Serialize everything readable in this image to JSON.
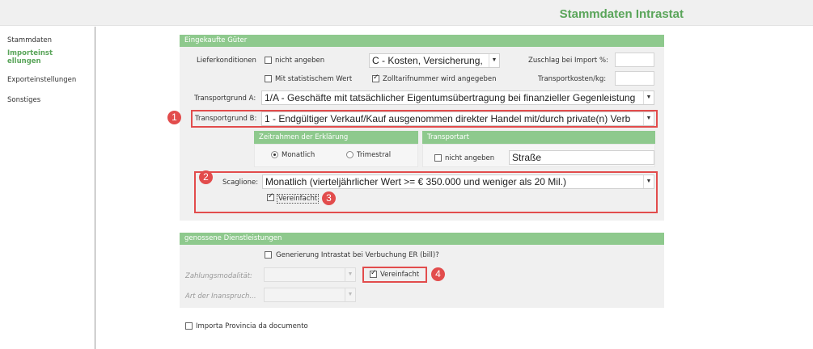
{
  "header": {
    "title": "Stammdaten Intrastat"
  },
  "sidebar": {
    "items": [
      {
        "label": "Stammdaten",
        "active": false
      },
      {
        "label": "Importeinstellungen",
        "active": true
      },
      {
        "label": "Exporteinstellungen",
        "active": false
      },
      {
        "label": "Sonstiges",
        "active": false
      }
    ]
  },
  "purchased": {
    "title": "Eingekaufte Güter",
    "delivery_label": "Lieferkonditionen",
    "not_specified_label": "nicht angeben",
    "not_specified_checked": false,
    "delivery_value": "C - Kosten, Versicherung,",
    "surcharge_label": "Zuschlag bei Import %:",
    "statistical_value_label": "Mit statistischem Wert",
    "statistical_value_checked": false,
    "tariff_number_label": "Zolltarifnummer wird angegeben",
    "tariff_number_checked": true,
    "transport_costs_label": "Transportkosten/kg:",
    "reason_a_label": "Transportgrund A:",
    "reason_a_value": "1/A - Geschäfte mit tatsächlicher Eigentumsübertragung bei finanzieller Gegenleistung",
    "reason_b_label": "Transportgrund B:",
    "reason_b_value": "1 - Endgültiger Verkauf/Kauf ausgenommen direkter Handel mit/durch private(n) Verb",
    "period": {
      "title": "Zeitrahmen der Erklärung",
      "monthly_label": "Monatlich",
      "quarterly_label": "Trimestral",
      "selected": "Monatlich"
    },
    "transport": {
      "title": "Transportart",
      "not_specified_label": "nicht angeben",
      "not_specified_checked": false,
      "value": "Straße"
    },
    "scaglione_label": "Scaglione:",
    "scaglione_value": "Monatlich (vierteljährlicher Wert >= € 350.000 und weniger als 20 Mil.)",
    "simplified_label": "Vereinfacht",
    "simplified_checked": true
  },
  "services": {
    "title": "genossene Dienstleistungen",
    "generate_label": "Generierung Intrastat bei Verbuchung ER (bill)?",
    "generate_checked": false,
    "payment_label": "Zahlungsmodalität:",
    "claim_label": "Art der Inanspruch...",
    "simplified_label": "Vereinfacht",
    "simplified_checked": true
  },
  "import_province_label": "Importa Provincia da documento",
  "import_province_checked": false,
  "callouts": [
    "1",
    "2",
    "3",
    "4"
  ],
  "colors": {
    "accent": "#5aa55a",
    "panel_header": "#8ec98d",
    "callout": "#e24c4c"
  },
  "icons": {
    "dropdown": "chevron-down-icon",
    "checkbox": "checkbox-icon",
    "radio": "radio-icon"
  }
}
